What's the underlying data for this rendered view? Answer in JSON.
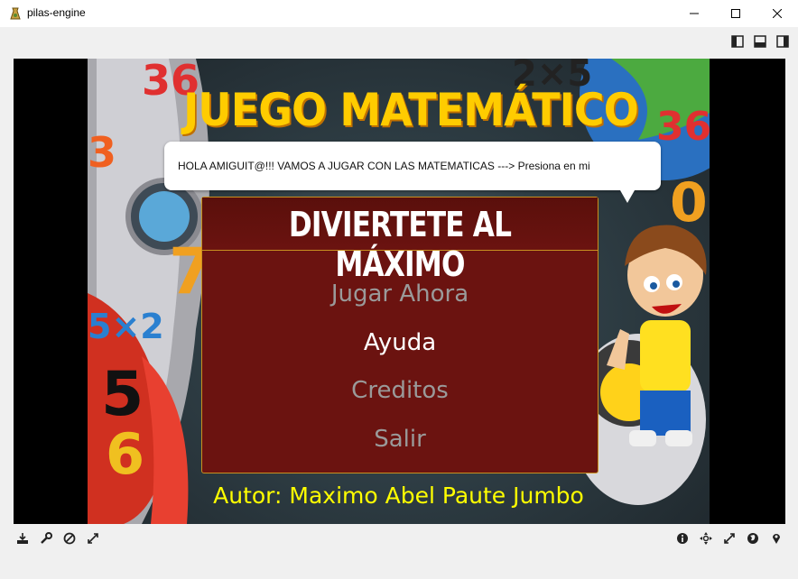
{
  "window": {
    "title": "pilas-engine"
  },
  "game": {
    "title": "JUEGO MATEMÁTICO",
    "speech_bubble": "HOLA AMIGUIT@!!! VAMOS A JUGAR CON LAS MATEMATICAS  ---> Presiona en mi",
    "menu": {
      "title": "DIVIERTETE AL MÁXIMO",
      "items": [
        {
          "label": "Jugar Ahora",
          "selected": false
        },
        {
          "label": "Ayuda",
          "selected": true
        },
        {
          "label": "Creditos",
          "selected": false
        },
        {
          "label": "Salir",
          "selected": false
        }
      ]
    },
    "author": "Autor: Maximo Abel Paute Jumbo",
    "background_numbers": [
      "36",
      "2×5",
      "5×2",
      "5",
      "6",
      "7",
      "3",
      "0",
      "36"
    ]
  },
  "toolbar_left": [
    "save-icon",
    "wrench-icon",
    "disable-icon",
    "fullscreen-icon"
  ],
  "toolbar_right": [
    "info-icon",
    "move-icon",
    "resize-icon",
    "globe-icon",
    "location-icon"
  ],
  "colors": {
    "menu_bg": "#6b1310",
    "menu_border": "#c89020",
    "title_yellow": "#ffcc00",
    "author_yellow": "#ffff00"
  }
}
